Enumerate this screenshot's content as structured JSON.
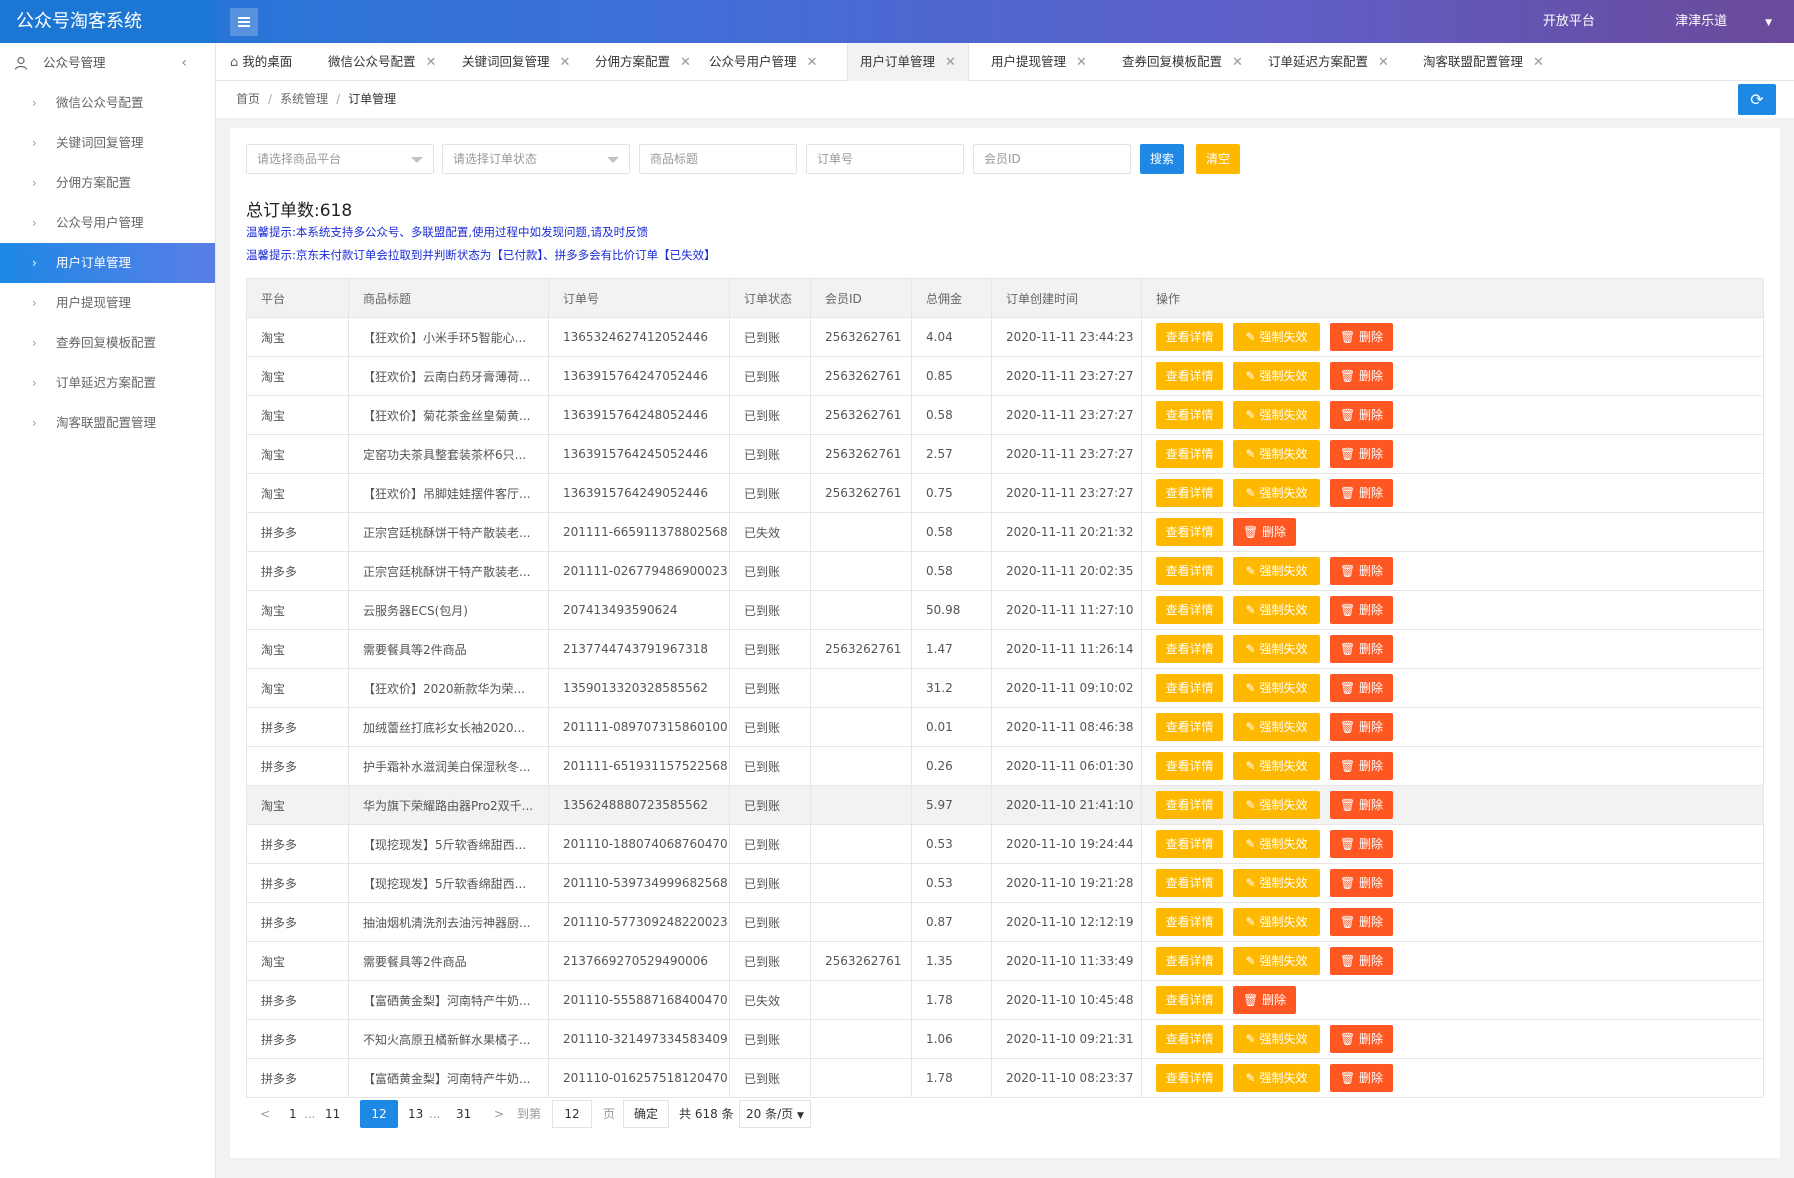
{
  "app": {
    "title": "公众号淘客系统"
  },
  "topbar": {
    "open_platform": "开放平台",
    "user": "津津乐道"
  },
  "sidebar": {
    "group_label": "公众号管理",
    "items": [
      {
        "label": "微信公众号配置"
      },
      {
        "label": "关键词回复管理"
      },
      {
        "label": "分佣方案配置"
      },
      {
        "label": "公众号用户管理"
      },
      {
        "label": "用户订单管理",
        "active": true
      },
      {
        "label": "用户提现管理"
      },
      {
        "label": "查券回复模板配置"
      },
      {
        "label": "订单延迟方案配置"
      },
      {
        "label": "淘客联盟配置管理"
      }
    ]
  },
  "tabs": [
    {
      "label": "我的桌面"
    },
    {
      "label": "微信公众号配置"
    },
    {
      "label": "关键词回复管理"
    },
    {
      "label": "分佣方案配置"
    },
    {
      "label": "公众号用户管理"
    },
    {
      "label": "用户订单管理",
      "active": true
    },
    {
      "label": "用户提现管理"
    },
    {
      "label": "查券回复模板配置"
    },
    {
      "label": "订单延迟方案配置"
    },
    {
      "label": "淘客联盟配置管理"
    }
  ],
  "breadcrumb": {
    "home": "首页",
    "section": "系统管理",
    "current": "订单管理"
  },
  "filters": {
    "platform_placeholder": "请选择商品平台",
    "status_placeholder": "请选择订单状态",
    "title_placeholder": "商品标题",
    "order_placeholder": "订单号",
    "member_placeholder": "会员ID",
    "search_label": "搜索",
    "clear_label": "清空"
  },
  "summary": {
    "total_label": "总订单数:618",
    "tip1": "温馨提示:本系统支持多公众号、多联盟配置,使用过程中如发现问题,请及时反馈",
    "tip2": "温馨提示:京东未付款订单会拉取到并判断状态为【已付款】、拼多多会有比价订单【已失效】"
  },
  "table": {
    "headers": [
      "平台",
      "商品标题",
      "订单号",
      "订单状态",
      "会员ID",
      "总佣金",
      "订单创建时间",
      "操作"
    ],
    "actions": {
      "detail": "查看详情",
      "void": "强制失效",
      "delete": "删除"
    },
    "rows": [
      {
        "platform": "淘宝",
        "title": "【狂欢价】小米手环5智能心...",
        "order": "1365324627412052446",
        "status": "已到账",
        "member": "2563262761",
        "commission": "4.04",
        "time": "2020-11-11 23:44:23",
        "void": true
      },
      {
        "platform": "淘宝",
        "title": "【狂欢价】云南白药牙膏薄荷...",
        "order": "1363915764247052446",
        "status": "已到账",
        "member": "2563262761",
        "commission": "0.85",
        "time": "2020-11-11 23:27:27",
        "void": true
      },
      {
        "platform": "淘宝",
        "title": "【狂欢价】菊花茶金丝皇菊黄...",
        "order": "1363915764248052446",
        "status": "已到账",
        "member": "2563262761",
        "commission": "0.58",
        "time": "2020-11-11 23:27:27",
        "void": true
      },
      {
        "platform": "淘宝",
        "title": "定窑功夫茶具整套装茶杯6只...",
        "order": "1363915764245052446",
        "status": "已到账",
        "member": "2563262761",
        "commission": "2.57",
        "time": "2020-11-11 23:27:27",
        "void": true
      },
      {
        "platform": "淘宝",
        "title": "【狂欢价】吊脚娃娃摆件客厅...",
        "order": "1363915764249052446",
        "status": "已到账",
        "member": "2563262761",
        "commission": "0.75",
        "time": "2020-11-11 23:27:27",
        "void": true
      },
      {
        "platform": "拼多多",
        "title": "正宗宫廷桃酥饼干特产散装老...",
        "order": "201111-665911378802568",
        "status": "已失效",
        "member": "",
        "commission": "0.58",
        "time": "2020-11-11 20:21:32",
        "void": false
      },
      {
        "platform": "拼多多",
        "title": "正宗宫廷桃酥饼干特产散装老...",
        "order": "201111-026779486900023",
        "status": "已到账",
        "member": "",
        "commission": "0.58",
        "time": "2020-11-11 20:02:35",
        "void": true
      },
      {
        "platform": "淘宝",
        "title": "云服务器ECS(包月)",
        "order": "207413493590624",
        "status": "已到账",
        "member": "",
        "commission": "50.98",
        "time": "2020-11-11 11:27:10",
        "void": true
      },
      {
        "platform": "淘宝",
        "title": "需要餐具等2件商品",
        "order": "2137744743791967318",
        "status": "已到账",
        "member": "2563262761",
        "commission": "1.47",
        "time": "2020-11-11 11:26:14",
        "void": true
      },
      {
        "platform": "淘宝",
        "title": "【狂欢价】2020新款华为荣...",
        "order": "1359013320328585562",
        "status": "已到账",
        "member": "",
        "commission": "31.2",
        "time": "2020-11-11 09:10:02",
        "void": true
      },
      {
        "platform": "拼多多",
        "title": "加绒蕾丝打底衫女长袖2020...",
        "order": "201111-089707315860100",
        "status": "已到账",
        "member": "",
        "commission": "0.01",
        "time": "2020-11-11 08:46:38",
        "void": true
      },
      {
        "platform": "拼多多",
        "title": "护手霜补水滋润美白保湿秋冬...",
        "order": "201111-651931157522568",
        "status": "已到账",
        "member": "",
        "commission": "0.26",
        "time": "2020-11-11 06:01:30",
        "void": true
      },
      {
        "platform": "淘宝",
        "title": "华为旗下荣耀路由器Pro2双千...",
        "order": "1356248880723585562",
        "status": "已到账",
        "member": "",
        "commission": "5.97",
        "time": "2020-11-10 21:41:10",
        "void": true,
        "highlight": true
      },
      {
        "platform": "拼多多",
        "title": "【现挖现发】5斤软香绵甜西...",
        "order": "201110-188074068760470",
        "status": "已到账",
        "member": "",
        "commission": "0.53",
        "time": "2020-11-10 19:24:44",
        "void": true
      },
      {
        "platform": "拼多多",
        "title": "【现挖现发】5斤软香绵甜西...",
        "order": "201110-539734999682568",
        "status": "已到账",
        "member": "",
        "commission": "0.53",
        "time": "2020-11-10 19:21:28",
        "void": true
      },
      {
        "platform": "拼多多",
        "title": "抽油烟机清洗剂去油污神器厨...",
        "order": "201110-577309248220023",
        "status": "已到账",
        "member": "",
        "commission": "0.87",
        "time": "2020-11-10 12:12:19",
        "void": true
      },
      {
        "platform": "淘宝",
        "title": "需要餐具等2件商品",
        "order": "2137669270529490006",
        "status": "已到账",
        "member": "2563262761",
        "commission": "1.35",
        "time": "2020-11-10 11:33:49",
        "void": true
      },
      {
        "platform": "拼多多",
        "title": "【富硒黄金梨】河南特产牛奶...",
        "order": "201110-555887168400470",
        "status": "已失效",
        "member": "",
        "commission": "1.78",
        "time": "2020-11-10 10:45:48",
        "void": false
      },
      {
        "platform": "拼多多",
        "title": "不知火高原丑橘新鲜水果橘子...",
        "order": "201110-321497334583409",
        "status": "已到账",
        "member": "",
        "commission": "1.06",
        "time": "2020-11-10 09:21:31",
        "void": true
      },
      {
        "platform": "拼多多",
        "title": "【富硒黄金梨】河南特产牛奶...",
        "order": "201110-016257518120470",
        "status": "已到账",
        "member": "",
        "commission": "1.78",
        "time": "2020-11-10 08:23:37",
        "void": true
      }
    ]
  },
  "pager": {
    "p1": "1",
    "dots1": "...",
    "p11": "11",
    "current": "12",
    "p13": "13",
    "dots2": "...",
    "p31": "31",
    "goto_label": "到第",
    "goto_value": "12",
    "page_label": "页",
    "confirm": "确定",
    "total": "共 618 条",
    "per_page": "20 条/页"
  }
}
